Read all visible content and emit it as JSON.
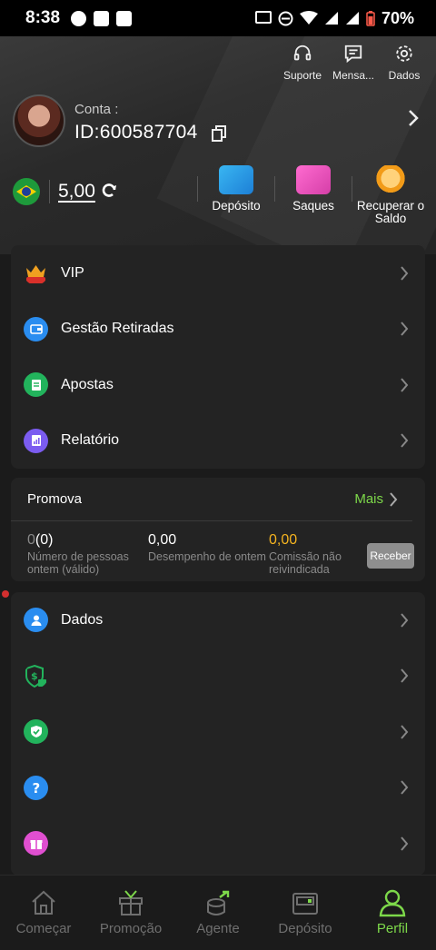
{
  "status_bar": {
    "time": "8:38",
    "battery": "70%"
  },
  "top_links": [
    {
      "label": "Suporte",
      "icon": "headset-icon"
    },
    {
      "label": "Mensa...",
      "icon": "message-icon"
    },
    {
      "label": "Dados",
      "icon": "gear-icon"
    }
  ],
  "account": {
    "label": "Conta :",
    "id": "ID:600587704"
  },
  "wallet": {
    "balance": "5,00"
  },
  "actions": [
    {
      "label": "Depósito",
      "icon": "deposit-card-icon"
    },
    {
      "label": "Saques",
      "icon": "withdraw-card-icon"
    },
    {
      "label": "Recuperar o Saldo",
      "icon": "coins-icon"
    }
  ],
  "menu_primary": [
    {
      "label": "VIP",
      "icon": "vip-crown-icon",
      "color": "#f0a020"
    },
    {
      "label": "Gestão Retiradas",
      "icon": "wallet-icon",
      "color": "#2a8df0"
    },
    {
      "label": "Apostas",
      "icon": "document-icon",
      "color": "#22b35c"
    },
    {
      "label": "Relatório",
      "icon": "report-icon",
      "color": "#7b5cf0"
    }
  ],
  "promo": {
    "title": "Promova",
    "more": "Mais",
    "stats": [
      {
        "value_dim": "0",
        "value": "(0)",
        "label": "Número de pessoas ontem (válido)"
      },
      {
        "value_dim": "",
        "value": "0,00",
        "label": "Desempenho de ontem"
      },
      {
        "value_dim": "",
        "value": "0,00",
        "label": "Comissão não reivindicada"
      }
    ],
    "button": "Receber"
  },
  "menu_secondary": [
    {
      "label": "Dados",
      "icon": "user-icon",
      "color": "#2a8df0"
    },
    {
      "label": "",
      "icon": "dollar-shield-lock-icon",
      "color": "#22b35c"
    },
    {
      "label": "",
      "icon": "shield-check-icon",
      "color": "#22b35c"
    },
    {
      "label": "",
      "icon": "question-icon",
      "color": "#2a8df0"
    },
    {
      "label": "",
      "icon": "gift-icon",
      "color": "#e04fd0"
    }
  ],
  "tabs": [
    {
      "label": "Começar",
      "icon": "home-icon",
      "active": false
    },
    {
      "label": "Promoção",
      "icon": "gift-box-icon",
      "active": false
    },
    {
      "label": "Agente",
      "icon": "agent-coins-icon",
      "active": false
    },
    {
      "label": "Depósito",
      "icon": "wallet-tab-icon",
      "active": false
    },
    {
      "label": "Perfil",
      "icon": "profile-icon",
      "active": true
    }
  ],
  "colors": {
    "accent": "#7dd84a",
    "gold": "#f4b320",
    "background": "#1b1b1b",
    "card": "#232323"
  }
}
